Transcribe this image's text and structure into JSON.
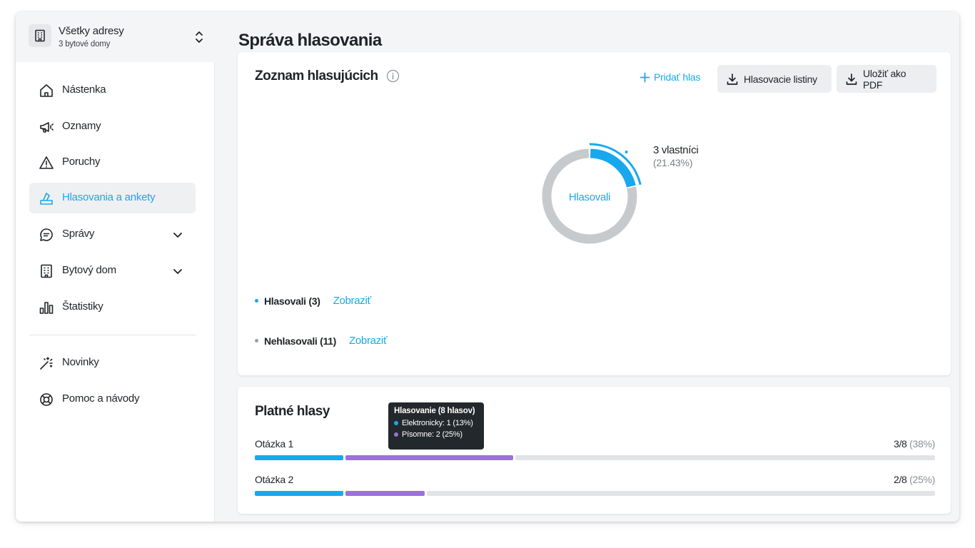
{
  "address": {
    "title": "Všetky adresy",
    "subtitle": "3 bytové domy"
  },
  "nav": {
    "dashboard": "Nástenka",
    "announcements": "Oznamy",
    "faults": "Poruchy",
    "votes": "Hlasovania a ankety",
    "messages": "Správy",
    "building": "Bytový dom",
    "statistics": "Štatistiky",
    "news": "Novinky",
    "help": "Pomoc a návody"
  },
  "page_title": "Správa hlasovania",
  "voters_card": {
    "title": "Zoznam hlasujúcich",
    "add_vote": "Pridať hlas",
    "ballots_button": "Hlasovacie listiny",
    "pdf_button": "Uložiť ako PDF",
    "donut": {
      "center_label": "Hlasovali",
      "voted_fraction": 0.2143,
      "annotation_count": "3 vlastníci",
      "annotation_percent": "(21.43%)"
    },
    "legend": [
      {
        "label": "Hlasovali (3)",
        "link": "Zobraziť",
        "color": "#17a8ee"
      },
      {
        "label": "Nehlasovali (11)",
        "link": "Zobraziť",
        "color": "#9aa0a6"
      }
    ]
  },
  "valid_votes_card": {
    "title": "Platné hlasy",
    "tooltip": {
      "title": "Hlasovanie (8 hlasov)",
      "rows": [
        {
          "label": "Elektronicky: 1 (13%)",
          "color": "#17a8ee"
        },
        {
          "label": "Písomne: 2 (25%)",
          "color": "#9b71dc"
        }
      ]
    },
    "questions": [
      {
        "label": "Otázka 1",
        "count": "3/8",
        "percent": "(38%)",
        "electronic_fraction": 0.13,
        "written_fraction": 0.25
      },
      {
        "label": "Otázka 2",
        "count": "2/8",
        "percent": "(25%)",
        "electronic_fraction": 0.13,
        "written_fraction": 0.12
      }
    ]
  },
  "colors": {
    "accent": "#17a8ee",
    "purple": "#9b71dc",
    "gray": "#c7cacd",
    "track": "#e1e3e6"
  }
}
